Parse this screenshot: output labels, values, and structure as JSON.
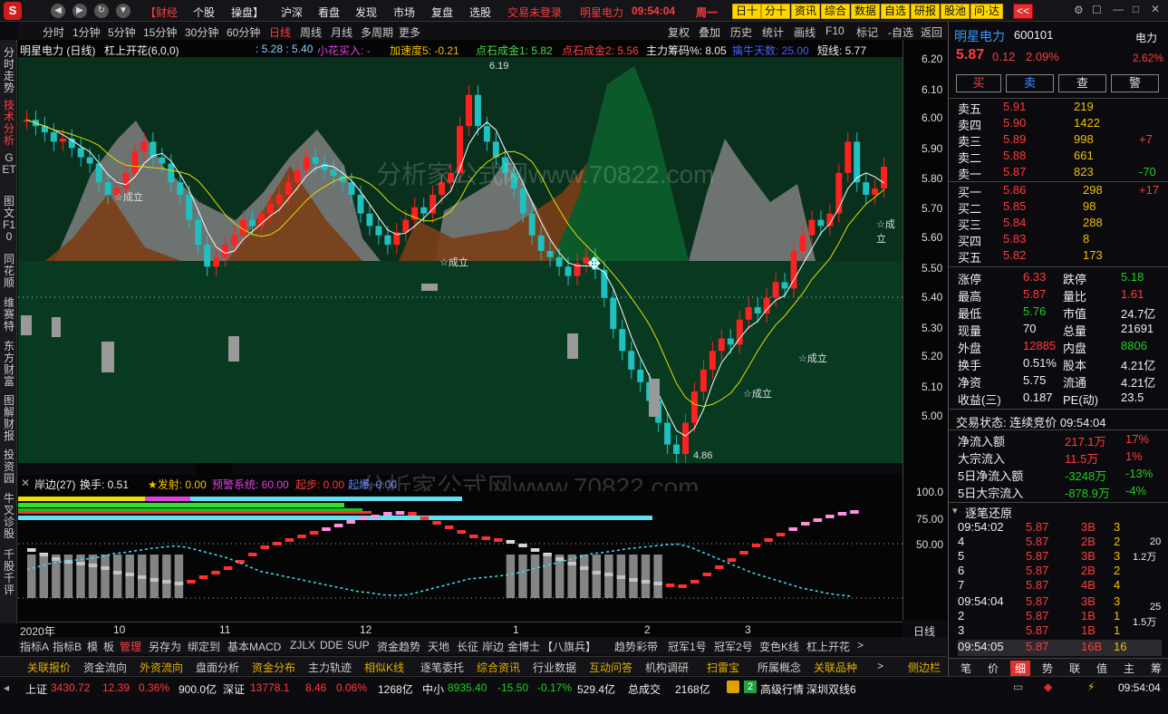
{
  "topbar": {
    "logo": "S",
    "menus": [
      "【财经",
      "个股",
      "操盘】",
      "沪深",
      "看盘",
      "发现",
      "市场",
      "复盘",
      "选股"
    ],
    "login": "交易未登录",
    "stock": "明星电力",
    "time": "09:54:04",
    "weekday": "周一",
    "buttons": [
      "日十",
      "分十",
      "资讯",
      "综合",
      "数据",
      "自选",
      "研报",
      "股池",
      "问·达"
    ],
    "collapse": "<<"
  },
  "periods": {
    "items": [
      "分时",
      "1分钟",
      "5分钟",
      "15分钟",
      "30分钟",
      "60分钟",
      "日线",
      "周线",
      "月线",
      "多周期",
      "更多"
    ],
    "active": "日线",
    "right": [
      "复权",
      "叠加",
      "历史",
      "统计",
      "画线",
      "F10",
      "标记",
      "-自选",
      "返回"
    ]
  },
  "left_tabs": [
    "分时走势",
    "技术分析",
    "GET",
    "图文F10",
    "同花顺",
    "维赛特",
    "东方财富",
    "图解财报",
    "投资园",
    "牛叉诊股",
    "千股千评"
  ],
  "chart_header": {
    "title": "明星电力 (日线)",
    "indicator": "杠上开花(6,0,0)",
    "v1": ": 5.28 : 5.40",
    "v2": "小花买入: -",
    "v3": "加速度5: -0.21",
    "v4": "点石成金1: 5.82",
    "v5": "点石成金2: 5.56",
    "v6": "主力筹码%: 8.05",
    "v7": "擒牛天数: 25.00",
    "v8": "短线: 5.77"
  },
  "main_labels": {
    "high": "6.19",
    "low": "4.86",
    "cheng1": "☆成立",
    "cheng2": "☆成立",
    "cheng3": "☆成立",
    "cheng4": "☆成立",
    "cheng5": "☆成立",
    "cai": "财",
    "watermark": "分析家公式网www.70822.com"
  },
  "price_scale": [
    "6.20",
    "6.10",
    "6.00",
    "5.90",
    "5.80",
    "5.70",
    "5.60",
    "5.50",
    "5.40",
    "5.30",
    "5.20",
    "5.10",
    "5.00"
  ],
  "sub_header": {
    "name": "岸边(27)",
    "turnover": "换手: 0.51",
    "fashe": "★发射: 0.00",
    "yujing": "预警系统: 60.00",
    "qibu": "起步: 0.00",
    "qidian": "起爆: 0.00",
    "watermark": "分析家公式网www.70822.com"
  },
  "sub_scale": [
    "100.0",
    "75.00",
    "50.00"
  ],
  "xaxis": {
    "labels": [
      "2020年",
      "10",
      "11",
      "12",
      "1",
      "2",
      "3"
    ],
    "period": "日线",
    "plus": "+",
    "minus": "-"
  },
  "toolbar1": {
    "items": [
      "指标A",
      "指标B",
      "模",
      "板",
      "管理",
      "另存为",
      "绑定到",
      "基本MACD",
      "ZJLX",
      "DDE",
      "SUP",
      "资金趋势",
      "天地",
      "长征",
      "岸边",
      "金博士",
      "【八旗兵】",
      "趋势彩带",
      "冠军1号",
      "冠军2号",
      "变色K线",
      "杠上开花"
    ],
    "arrow": ">"
  },
  "toolbar2": {
    "items": [
      "关联报价",
      "资金流向",
      "外资流向",
      "盘面分析",
      "资金分布",
      "主力轨迹",
      "相似K线",
      "逐笔委托",
      "综合资讯",
      "行业数据",
      "互动问答",
      "机构调研",
      "扫雷宝",
      "所属概念",
      "关联品种"
    ],
    "arrow": ">",
    "side": "侧边栏"
  },
  "status": {
    "sh_name": "上证",
    "sh_price": "3430.72",
    "sh_chg": "12.39",
    "sh_pct": "0.36%",
    "sh_amt": "900.0亿",
    "sz_name": "深证",
    "sz_price": "13778.1",
    "sz_chg": "8.46",
    "sz_pct": "0.06%",
    "sz_amt": "1268亿",
    "zx_name": "中小",
    "zx_price": "8935.40",
    "zx_chg": "-15.50",
    "zx_pct": "-0.17%",
    "zx_amt": "529.4亿",
    "total_label": "总成交",
    "total": "2168亿",
    "badge": "2",
    "hq": "高级行情",
    "line": "深圳双线6",
    "time": "09:54:04"
  },
  "panel": {
    "name": "明星电力",
    "code": "600101",
    "sector": "电力",
    "price": "5.87",
    "chg": "0.12",
    "pct": "2.09%",
    "sector_pct": "2.62%",
    "actions": [
      "买",
      "卖",
      "查",
      "警"
    ],
    "asks": [
      [
        "卖五",
        "5.91",
        "219",
        ""
      ],
      [
        "卖四",
        "5.90",
        "1422",
        ""
      ],
      [
        "卖三",
        "5.89",
        "998",
        "+7"
      ],
      [
        "卖二",
        "5.88",
        "661",
        ""
      ],
      [
        "卖一",
        "5.87",
        "823",
        "-70"
      ]
    ],
    "bids": [
      [
        "买一",
        "5.86",
        "298",
        "+17"
      ],
      [
        "买二",
        "5.85",
        "98",
        ""
      ],
      [
        "买三",
        "5.84",
        "288",
        ""
      ],
      [
        "买四",
        "5.83",
        "8",
        ""
      ],
      [
        "买五",
        "5.82",
        "173",
        ""
      ]
    ],
    "stats": [
      [
        "涨停",
        "6.33",
        "跌停",
        "5.18"
      ],
      [
        "最高",
        "5.87",
        "量比",
        "1.61"
      ],
      [
        "最低",
        "5.76",
        "市值",
        "24.7亿"
      ],
      [
        "现量",
        "70",
        "总量",
        "21691"
      ],
      [
        "外盘",
        "12885",
        "内盘",
        "8806"
      ],
      [
        "换手",
        "0.51%",
        "股本",
        "4.21亿"
      ],
      [
        "净资",
        "5.75",
        "流通",
        "4.21亿"
      ],
      [
        "收益(三)",
        "0.187",
        "PE(动)",
        "23.5"
      ]
    ],
    "trade_state": "交易状态: 连续竞价 09:54:04",
    "flows": [
      [
        "净流入额",
        "217.1万",
        "17%"
      ],
      [
        "大宗流入",
        "11.5万",
        "1%"
      ],
      [
        "5日净流入额",
        "-3248万",
        "-13%"
      ],
      [
        "5日大宗流入",
        "-878.9万",
        "-4%"
      ]
    ],
    "ticks_title": "逐笔还原",
    "ticks": [
      [
        "09:54:02",
        "5.87",
        "3B",
        "3"
      ],
      [
        "4",
        "5.87",
        "2B",
        "2"
      ],
      [
        "5",
        "5.87",
        "3B",
        "3"
      ],
      [
        "6",
        "5.87",
        "2B",
        "2"
      ],
      [
        "7",
        "5.87",
        "4B",
        "4"
      ],
      [
        "09:54:04",
        "5.87",
        "3B",
        "3"
      ],
      [
        "2",
        "5.87",
        "1B",
        "1"
      ],
      [
        "3",
        "5.87",
        "1B",
        "1"
      ],
      [
        "09:54:05",
        "5.87",
        "16B",
        "16"
      ]
    ],
    "tick_side": [
      "20",
      "1.2万",
      "25",
      "1.5万"
    ],
    "bottom_tabs": [
      "笔",
      "价",
      "细",
      "势",
      "联",
      "值",
      "主",
      "筹"
    ],
    "bottom_active": "细"
  },
  "chart_data": {
    "type": "candlestick",
    "title": "明星电力 (日线)",
    "x_labels": [
      "2020年",
      "10",
      "11",
      "12",
      "1",
      "2",
      "3"
    ],
    "ylim": [
      4.86,
      6.19
    ],
    "y_ticks": [
      5.0,
      5.1,
      5.2,
      5.3,
      5.4,
      5.5,
      5.6,
      5.7,
      5.8,
      5.9,
      6.0,
      6.1,
      6.2
    ],
    "closes": [
      6.02,
      6.0,
      5.98,
      5.95,
      5.96,
      5.93,
      5.9,
      5.88,
      5.82,
      5.78,
      5.8,
      5.85,
      5.92,
      5.95,
      5.9,
      5.88,
      5.82,
      5.78,
      5.7,
      5.62,
      5.55,
      5.58,
      5.62,
      5.65,
      5.7,
      5.68,
      5.72,
      5.75,
      5.78,
      5.82,
      5.86,
      5.9,
      5.88,
      5.86,
      5.84,
      5.82,
      5.78,
      5.72,
      5.68,
      5.65,
      5.62,
      5.66,
      5.7,
      5.74,
      5.72,
      5.78,
      5.82,
      5.85,
      6.0,
      6.1,
      6.0,
      5.95,
      5.9,
      5.85,
      5.8,
      5.72,
      5.65,
      5.6,
      5.58,
      5.55,
      5.52,
      5.56,
      5.58,
      5.54,
      5.45,
      5.35,
      5.28,
      5.22,
      5.18,
      5.12,
      5.05,
      4.98,
      4.95,
      5.05,
      5.15,
      5.22,
      5.28,
      5.32,
      5.3,
      5.38,
      5.42,
      5.4,
      5.45,
      5.5,
      5.48,
      5.6,
      5.65,
      5.7,
      5.68,
      5.72,
      5.85,
      5.95,
      5.82,
      5.78,
      5.8,
      5.87
    ]
  }
}
